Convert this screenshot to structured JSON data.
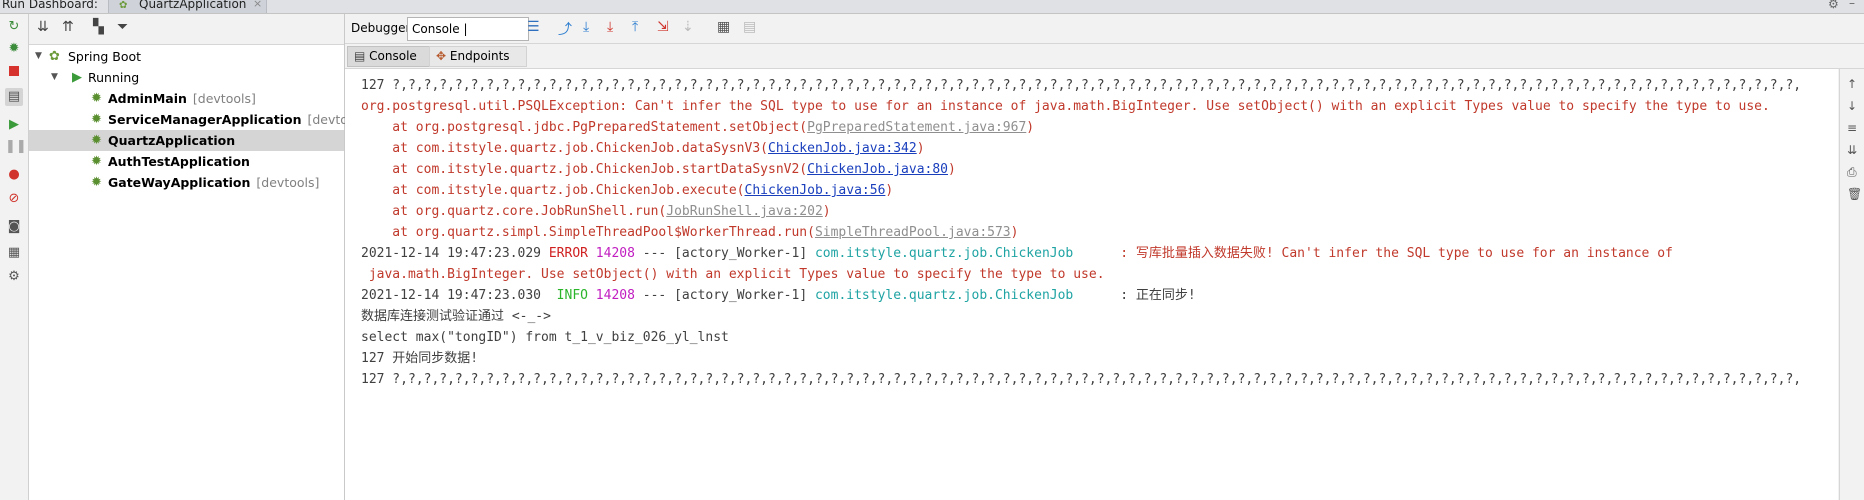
{
  "titlebar": {
    "label": "Run Dashboard:",
    "tab": "QuartzApplication",
    "close": "×"
  },
  "tree": {
    "root": "Spring Boot",
    "group": "Running",
    "apps": [
      {
        "name": "AdminMain",
        "tag": "[devtools]"
      },
      {
        "name": "ServiceManagerApplication",
        "tag": "[devtools]"
      },
      {
        "name": "QuartzApplication",
        "tag": ""
      },
      {
        "name": "AuthTestApplication",
        "tag": ""
      },
      {
        "name": "GateWayApplication",
        "tag": "[devtools]"
      }
    ],
    "selected": "QuartzApplication"
  },
  "tabs": {
    "debugger": "Debugger",
    "console_endpoints": "Console | Endpoints",
    "console": "Console",
    "endpoints": "Endpoints",
    "pin": "→*"
  },
  "console": {
    "l1": "127 ?,?,?,?,?,?,?,?,?,?,?,?,?,?,?,?,?,?,?,?,?,?,?,?,?,?,?,?,?,?,?,?,?,?,?,?,?,?,?,?,?,?,?,?,?,?,?,?,?,?,?,?,?,?,?,?,?,?,?,?,?,?,?,?,?,?,?,?,?,?,?,?,?,?,?,?,?,?,?,?,?,?,?,?,?,?,?,?,?,?,",
    "l2": "org.postgresql.util.PSQLException: Can't infer the SQL type to use for an instance of java.math.BigInteger. Use setObject() with an explicit Types value to specify the type to use.",
    "st": [
      {
        "pre": "    at org.postgresql.jdbc.PgPreparedStatement.setObject(",
        "link": "PgPreparedStatement.java:967",
        "gray": true
      },
      {
        "pre": "    at com.itstyle.quartz.job.ChickenJob.dataSysnV3(",
        "link": "ChickenJob.java:342",
        "gray": false
      },
      {
        "pre": "    at com.itstyle.quartz.job.ChickenJob.startDataSysnV2(",
        "link": "ChickenJob.java:80",
        "gray": false
      },
      {
        "pre": "    at com.itstyle.quartz.job.ChickenJob.execute(",
        "link": "ChickenJob.java:56",
        "gray": false
      },
      {
        "pre": "    at org.quartz.core.JobRunShell.run(",
        "link": "JobRunShell.java:202",
        "gray": true
      },
      {
        "pre": "    at org.quartz.simpl.SimpleThreadPool$WorkerThread.run(",
        "link": "SimpleThreadPool.java:573",
        "gray": true
      }
    ],
    "close_paren": ")",
    "log1": {
      "time": "2021-12-14 19:47:23.029 ",
      "level": "ERROR",
      "pid": " 14208",
      "mid": " --- [actory_Worker-1] ",
      "logger": "com.itstyle.quartz.job.ChickenJob",
      "msg": "      : 写库批量插入数据失败! Can't infer the SQL type to use for an instance of",
      "cont": " java.math.BigInteger. Use setObject() with an explicit Types value to specify the type to use."
    },
    "log2": {
      "time": "2021-12-14 19:47:23.030  ",
      "level": "INFO",
      "pid": " 14208",
      "mid": " --- [actory_Worker-1] ",
      "logger": "com.itstyle.quartz.job.ChickenJob",
      "msg": "      : 正在同步!"
    },
    "l_db": "数据库连接测试验证通过 <-_->",
    "l_sql": "select max(\"tongID\") from t_1_v_biz_026_yl_lnst",
    "l_start": "127 开始同步数据!",
    "l_last": "127 ?,?,?,?,?,?,?,?,?,?,?,?,?,?,?,?,?,?,?,?,?,?,?,?,?,?,?,?,?,?,?,?,?,?,?,?,?,?,?,?,?,?,?,?,?,?,?,?,?,?,?,?,?,?,?,?,?,?,?,?,?,?,?,?,?,?,?,?,?,?,?,?,?,?,?,?,?,?,?,?,?,?,?,?,?,?,?,?,?,?,"
  },
  "colors": {
    "error": "#c0392b",
    "link": "#1a3fbd",
    "logger": "#1fa3a3",
    "pid": "#c11ec1",
    "selection": "#d5d5d5"
  },
  "icons": [
    "rerun-icon",
    "debug-icon",
    "stop-icon",
    "layout-icon",
    "run-icon",
    "pause-icon",
    "breakpoints-icon",
    "mute-icon",
    "camera-icon",
    "layout2-icon",
    "settings-icon",
    "expand-all-icon",
    "collapse-all-icon",
    "group-icon",
    "filter-icon",
    "spring-icon",
    "run-arrow-icon",
    "app-icon"
  ]
}
